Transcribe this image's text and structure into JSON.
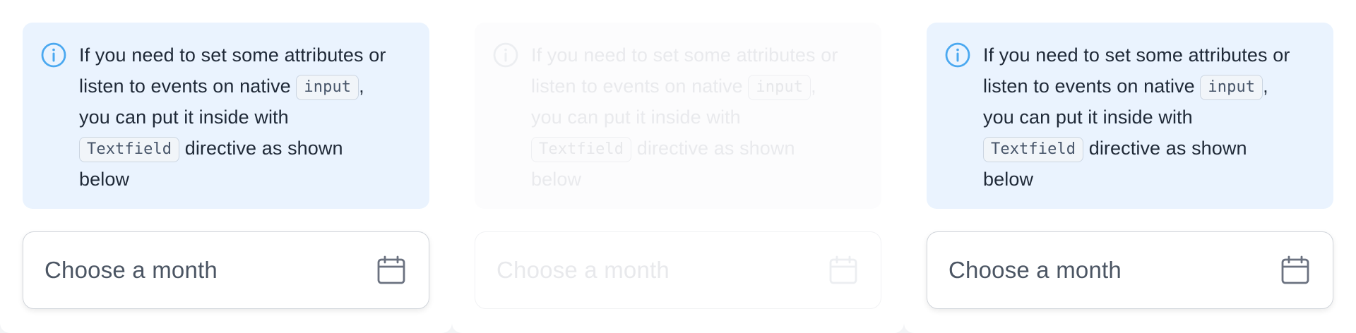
{
  "panels": [
    {
      "alert": {
        "line1": "If you need to set some attributes or",
        "line2_pre": "listen to events on native",
        "code_input": "input",
        "line2_post": ",",
        "line3": "you can put it inside with",
        "code_textfield": "Textfield",
        "line4_post": "directive as shown",
        "line5": "below"
      },
      "field": {
        "placeholder": "Choose a month"
      }
    },
    {
      "alert": {
        "line1": "If you need to set some attributes or",
        "line2_pre": "listen to events on native",
        "code_input": "input",
        "line2_post": ",",
        "line3": "you can put it inside with",
        "code_textfield": "Textfield",
        "line4_post": "directive as shown",
        "line5": "below"
      },
      "field": {
        "placeholder": "Choose a month"
      }
    },
    {
      "alert": {
        "line1": "If you need to set some attributes or",
        "line2_pre": "listen to events on native",
        "code_input": "input",
        "line2_post": ",",
        "line3": "you can put it inside with",
        "code_textfield": "Textfield",
        "line4_post": "directive as shown",
        "line5": "below"
      },
      "field": {
        "placeholder": "Choose a month"
      }
    }
  ],
  "colors": {
    "alert_bg": "#eaf3fe",
    "info_icon": "#4aa8f0",
    "text": "#1f2937",
    "field_border": "#d1d5db",
    "calendar_icon": "#6b7280"
  },
  "icons": {
    "info": "info-circle-icon",
    "calendar": "calendar-icon"
  }
}
